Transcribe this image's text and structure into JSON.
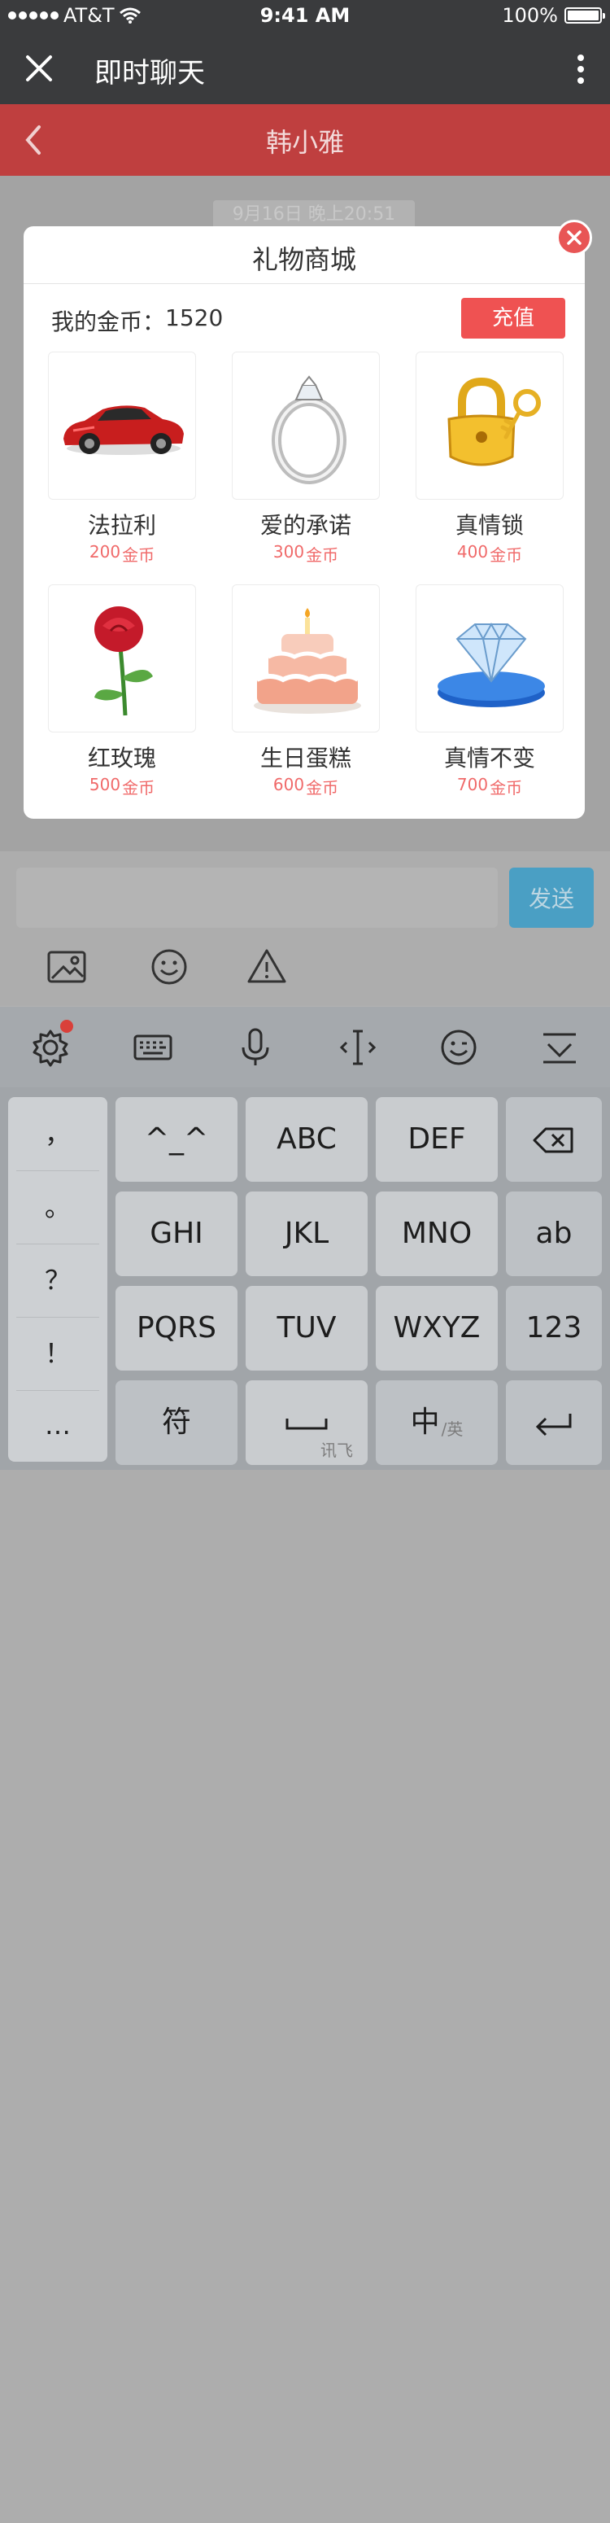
{
  "status_bar": {
    "carrier": "AT&T",
    "time": "9:41 AM",
    "battery": "100%"
  },
  "app_bar": {
    "title": "即时聊天",
    "close_icon": "close-icon",
    "more_icon": "more-vertical-icon"
  },
  "chat": {
    "contact_name": "韩小雅",
    "timestamp": "9月16日 晚上20:51"
  },
  "gift_shop": {
    "title": "礼物商城",
    "coins_label": "我的金币：",
    "coins_value": "1520",
    "recharge_label": "充值",
    "gifts": [
      {
        "name": "法拉利",
        "price": "200",
        "unit": "金币",
        "icon": "sports-car-icon"
      },
      {
        "name": "爱的承诺",
        "price": "300",
        "unit": "金币",
        "icon": "diamond-ring-icon"
      },
      {
        "name": "真情锁",
        "price": "400",
        "unit": "金币",
        "icon": "lock-and-key-icon"
      },
      {
        "name": "红玫瑰",
        "price": "500",
        "unit": "金币",
        "icon": "red-rose-icon"
      },
      {
        "name": "生日蛋糕",
        "price": "600",
        "unit": "金币",
        "icon": "birthday-cake-icon"
      },
      {
        "name": "真情不变",
        "price": "700",
        "unit": "金币",
        "icon": "diamond-icon"
      }
    ]
  },
  "composer": {
    "send_label": "发送",
    "tools": [
      "image-icon",
      "emoji-icon",
      "warning-icon"
    ]
  },
  "keyboard": {
    "toolbar": [
      "settings-icon",
      "keyboard-icon",
      "microphone-icon",
      "cursor-icon",
      "emoji-icon",
      "collapse-icon"
    ],
    "punctuation": [
      "，",
      "。",
      "？",
      "！",
      "…"
    ],
    "rows": [
      [
        "^_^",
        "ABC",
        "DEF"
      ],
      [
        "GHI",
        "JKL",
        "MNO"
      ],
      [
        "PQRS",
        "TUV",
        "WXYZ"
      ]
    ],
    "right_keys": [
      "ab",
      "123"
    ],
    "symbol_key": "符",
    "space_sub": "讯飞",
    "lang_key": "中",
    "lang_sub": "/英",
    "colors": {
      "accent": "#ef5252",
      "header": "#bf3f3f",
      "send": "#4a9fc4"
    }
  }
}
